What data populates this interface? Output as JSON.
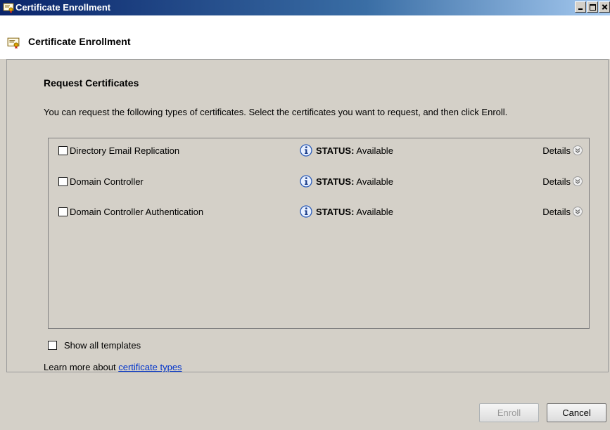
{
  "window": {
    "title": "Certificate Enrollment",
    "controls": [
      "minimize",
      "maximize",
      "close"
    ]
  },
  "header": {
    "title": "Certificate Enrollment"
  },
  "page": {
    "section_title": "Request Certificates",
    "instructions": "You can request the following types of certificates. Select the certificates you want to request, and then click Enroll."
  },
  "certificates": [
    {
      "name": "Directory Email Replication",
      "checked": false,
      "status_label": "STATUS:",
      "status_value": "Available",
      "details_label": "Details"
    },
    {
      "name": "Domain Controller",
      "checked": false,
      "status_label": "STATUS:",
      "status_value": "Available",
      "details_label": "Details"
    },
    {
      "name": "Domain Controller Authentication",
      "checked": false,
      "status_label": "STATUS:",
      "status_value": "Available",
      "details_label": "Details"
    }
  ],
  "options": {
    "show_all_label": "Show all templates",
    "show_all_checked": false
  },
  "learn_more": {
    "prefix": "Learn more about ",
    "link_text": "certificate types"
  },
  "buttons": {
    "enroll": "Enroll",
    "enroll_enabled": false,
    "cancel": "Cancel"
  },
  "icons": {
    "app": "certificate-icon",
    "status": "info-icon",
    "details": "expand-chevron-icon"
  },
  "colors": {
    "titlebar_start": "#0a246a",
    "titlebar_end": "#a6caf0",
    "link": "#0033cc",
    "info_icon": "#2a5bb8"
  }
}
